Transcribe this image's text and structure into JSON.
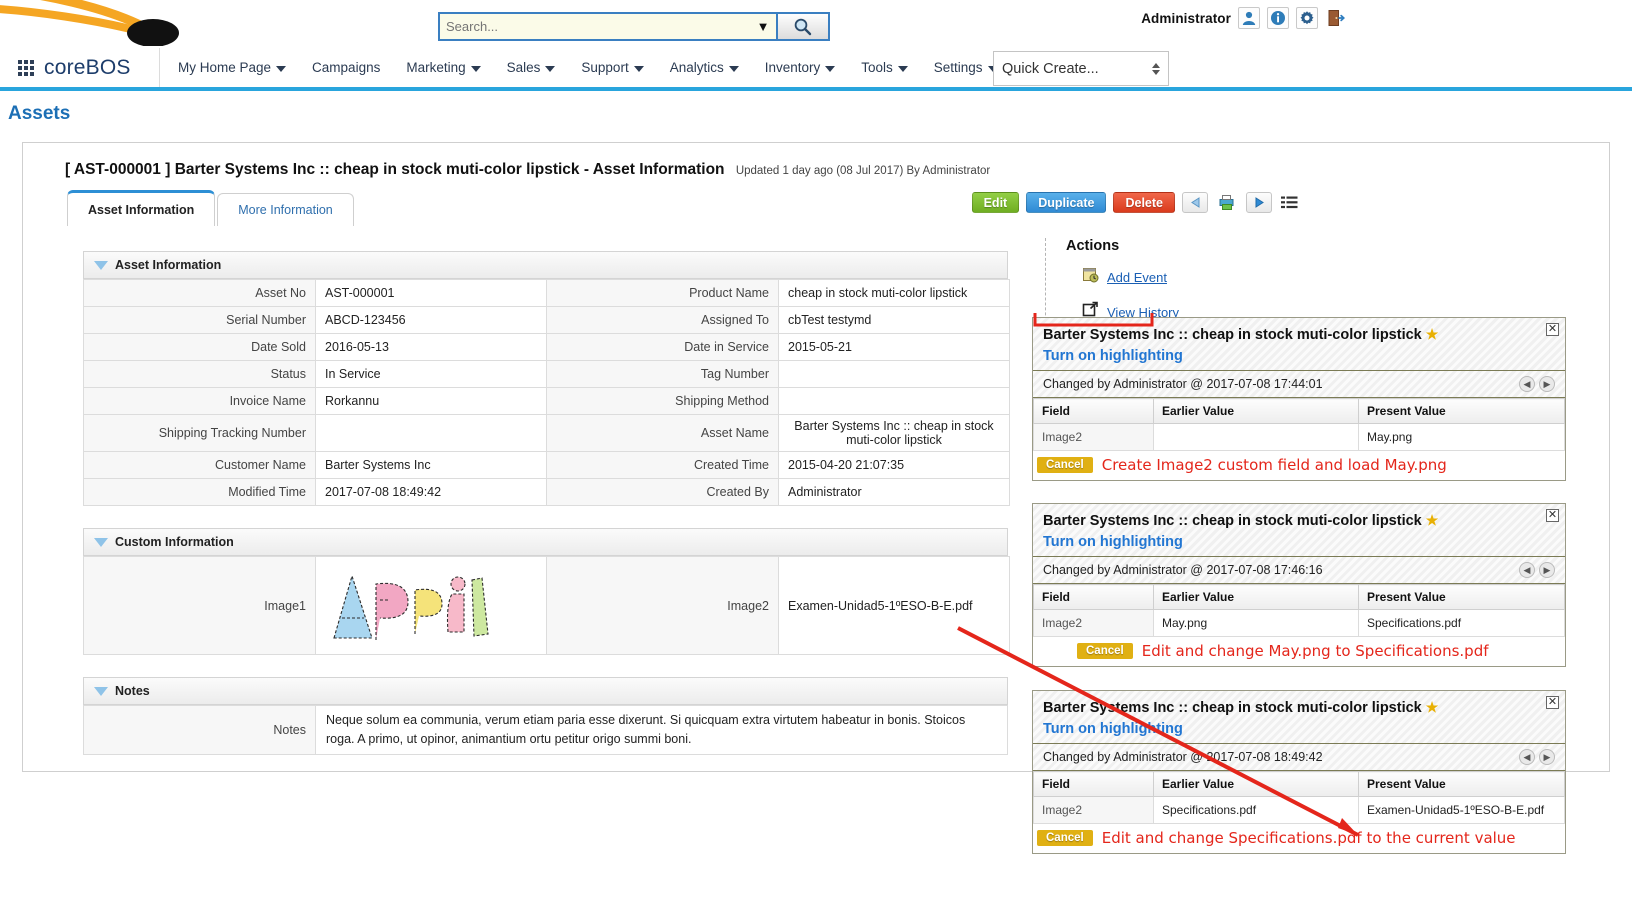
{
  "topbar": {
    "user_name": "Administrator",
    "icons": [
      "user-icon",
      "info-icon",
      "gear-icon",
      "logout-icon"
    ],
    "search": {
      "value": "",
      "placeholder": "Search...",
      "caret": "▼",
      "go_icon": "search-icon"
    }
  },
  "nav": {
    "brand": "coreBOS",
    "items": [
      {
        "label": "My Home Page",
        "has_menu": true
      },
      {
        "label": "Campaigns",
        "has_menu": false
      },
      {
        "label": "Marketing",
        "has_menu": true
      },
      {
        "label": "Sales",
        "has_menu": true
      },
      {
        "label": "Support",
        "has_menu": true
      },
      {
        "label": "Analytics",
        "has_menu": true
      },
      {
        "label": "Inventory",
        "has_menu": true
      },
      {
        "label": "Tools",
        "has_menu": true
      },
      {
        "label": "Settings",
        "has_menu": true
      }
    ],
    "quick_create": "Quick Create..."
  },
  "module": {
    "title": "Assets",
    "tools_group1": [
      "add-icon",
      "search-disabled-icon"
    ],
    "tools_group2": [
      "window-icon",
      "clock-icon",
      "mobile-icon",
      "clipboard-icon"
    ],
    "tools_group3": [
      "import-icon",
      "export-icon",
      "find-duplicates-icon"
    ],
    "tools_group4": [
      "settings-hammer-icon"
    ]
  },
  "record": {
    "title": "[ AST-000001 ] Barter Systems Inc :: cheap in stock muti-color lipstick - Asset Information",
    "updated": "Updated 1 day ago (08 Jul 2017) By Administrator",
    "tabs": [
      {
        "label": "Asset Information",
        "active": true
      },
      {
        "label": "More Information",
        "active": false
      }
    ],
    "buttons": [
      {
        "label": "Edit",
        "color": "#7cbb2e"
      },
      {
        "label": "Duplicate",
        "color": "#3d9ae0"
      },
      {
        "label": "Delete",
        "color": "#e44a2e"
      }
    ],
    "nav_icons": [
      "prev-arrow-icon",
      "print-icon",
      "next-arrow-icon",
      "list-view-icon"
    ]
  },
  "asset_information": {
    "section_title": "Asset Information",
    "rows": [
      {
        "l1": "Asset No",
        "v1": "AST-000001",
        "v1link": false,
        "l2": "Product Name",
        "v2": "cheap in stock muti-color lipstick",
        "v2link": true
      },
      {
        "l1": "Serial Number",
        "v1": "ABCD-123456",
        "v1link": false,
        "l2": "Assigned To",
        "v2": "cbTest testymd",
        "v2link": true
      },
      {
        "l1": "Date Sold",
        "v1": "2016-05-13",
        "v1link": false,
        "l2": "Date in Service",
        "v2": "2015-05-21",
        "v2link": false
      },
      {
        "l1": "Status",
        "v1": "In Service",
        "v1link": false,
        "l2": "Tag Number",
        "v2": "",
        "v2link": false
      },
      {
        "l1": "Invoice Name",
        "v1": "Rorkannu",
        "v1link": true,
        "l2": "Shipping Method",
        "v2": "",
        "v2link": false
      },
      {
        "l1": "Shipping Tracking Number",
        "v1": "",
        "v1link": false,
        "l2": "Asset Name",
        "v2": "Barter Systems Inc :: cheap in stock muti-color lipstick",
        "v2link": false
      },
      {
        "l1": "Customer Name",
        "v1": "Barter Systems Inc",
        "v1link": true,
        "l2": "Created Time",
        "v2": "2015-04-20 21:07:35",
        "v2link": false
      },
      {
        "l1": "Modified Time",
        "v1": "2017-07-08 18:49:42",
        "v1link": false,
        "l2": "Created By",
        "v2": "Administrator",
        "v2link": true
      }
    ]
  },
  "custom_information": {
    "section_title": "Custom Information",
    "image1_label": "Image1",
    "image1_alt": "april-lettering-image",
    "image2_label": "Image2",
    "image2_value": "Examen-Unidad5-1ºESO-B-E.pdf"
  },
  "notes_section": {
    "section_title": "Notes",
    "label": "Notes",
    "text": "Neque solum ea communia, verum etiam paria esse dixerunt. Si quicquam extra virtutem habeatur in bonis. Stoicos roga. A primo, ut opinor, animantium ortu petitur origo summi boni."
  },
  "actions": {
    "title": "Actions",
    "items": [
      {
        "label": "Add Event",
        "icon": "calendar-add-icon"
      },
      {
        "label": "View History",
        "icon": "popout-icon"
      }
    ]
  },
  "history_popups": [
    {
      "title": "Barter Systems Inc :: cheap in stock muti-color lipstick",
      "star": "★",
      "toggle": "Turn on highlighting",
      "close": "✕",
      "changed_by": "Changed by Administrator @ 2017-07-08 17:44:01",
      "columns": [
        "Field",
        "Earlier Value",
        "Present Value"
      ],
      "row": {
        "field": "Image2",
        "earlier": "",
        "present": "May.png"
      },
      "cancel": "Cancel",
      "annotation": "Create Image2 custom field and load May.png"
    },
    {
      "title": "Barter Systems Inc :: cheap in stock muti-color lipstick",
      "star": "★",
      "toggle": "Turn on highlighting",
      "close": "✕",
      "changed_by": "Changed by Administrator @ 2017-07-08 17:46:16",
      "columns": [
        "Field",
        "Earlier Value",
        "Present Value"
      ],
      "row": {
        "field": "Image2",
        "earlier": "May.png",
        "present": "Specifications.pdf"
      },
      "cancel": "Cancel",
      "annotation": "Edit and change May.png to Specifications.pdf"
    },
    {
      "title": "Barter Systems Inc :: cheap in stock muti-color lipstick",
      "star": "★",
      "toggle": "Turn on highlighting",
      "close": "✕",
      "changed_by": "Changed by Administrator @ 2017-07-08 18:49:42",
      "columns": [
        "Field",
        "Earlier Value",
        "Present Value"
      ],
      "row": {
        "field": "Image2",
        "earlier": "Specifications.pdf",
        "present": "Examen-Unidad5-1ºESO-B-E.pdf"
      },
      "cancel": "Cancel",
      "annotation": "Edit and change Specifications.pdf to the current value"
    }
  ],
  "colors": {
    "accent_blue": "#29a5dd",
    "link_blue": "#2f7ec0",
    "annotation_red": "#e4261b",
    "brand_orange": "#f5a623",
    "cancel_yellow": "#e0b013"
  }
}
